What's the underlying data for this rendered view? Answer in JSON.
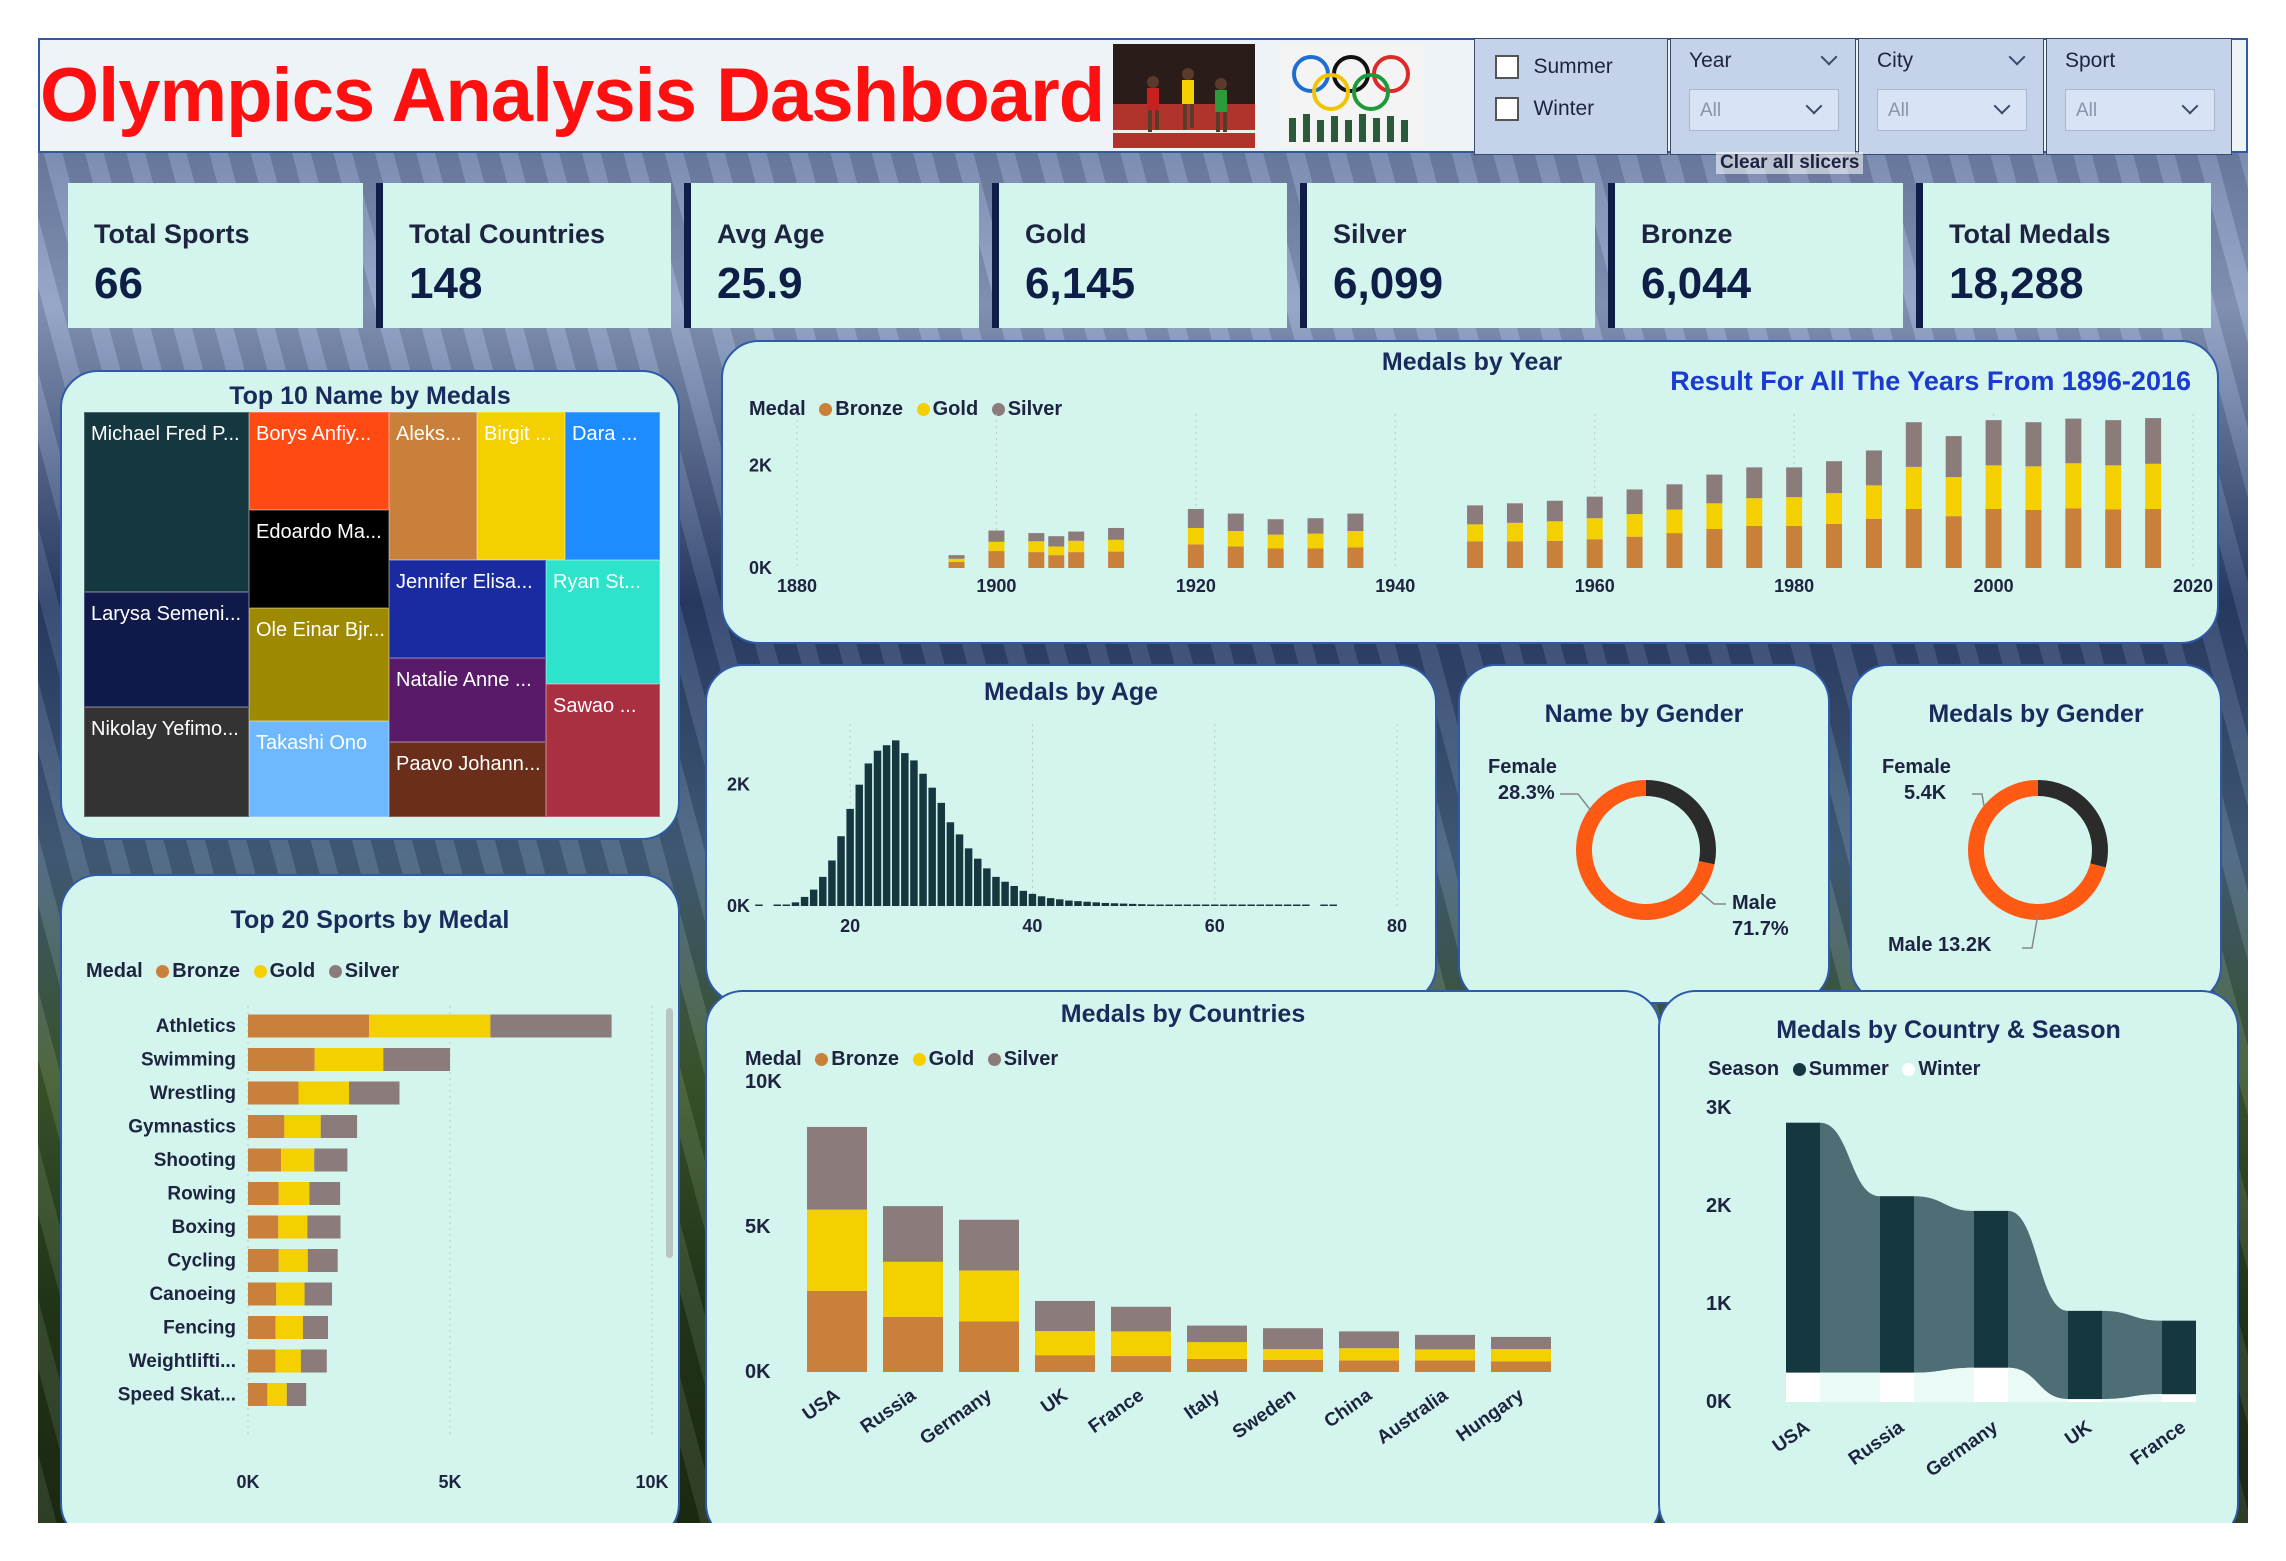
{
  "header": {
    "title": "Olympics Analysis Dashboard",
    "clear_slicers": "Clear all slicers"
  },
  "slicers": {
    "season_options": [
      "Summer",
      "Winter"
    ],
    "year": {
      "title": "Year",
      "value": "All"
    },
    "city": {
      "title": "City",
      "value": "All"
    },
    "sport": {
      "title": "Sport",
      "value": "All"
    }
  },
  "kpis": [
    {
      "label": "Total Sports",
      "value": "66"
    },
    {
      "label": "Total Countries",
      "value": "148"
    },
    {
      "label": "Avg Age",
      "value": "25.9"
    },
    {
      "label": "Gold",
      "value": "6,145"
    },
    {
      "label": "Silver",
      "value": "6,099"
    },
    {
      "label": "Bronze",
      "value": "6,044"
    },
    {
      "label": "Total Medals",
      "value": "18,288"
    }
  ],
  "colors": {
    "bronze": "#c9803a",
    "gold": "#f5d000",
    "silver": "#8c7b7b",
    "summer": "#15373f",
    "winter": "#ffffff",
    "female": "#2b2b2b",
    "male": "#ff5a14",
    "age_bar": "#15373f"
  },
  "treemap": {
    "title": "Top 10 Name by Medals",
    "cells": [
      {
        "label": "Michael Fred P...",
        "color": "#15373f"
      },
      {
        "label": "Larysa Semeni...",
        "color": "#101a4a"
      },
      {
        "label": "Nikolay Yefimo...",
        "color": "#333333"
      },
      {
        "label": "Borys Anfiy...",
        "color": "#ff4a14"
      },
      {
        "label": "Edoardo Ma...",
        "color": "#000000"
      },
      {
        "label": "Ole Einar Bjr...",
        "color": "#9e8a00"
      },
      {
        "label": "Takashi Ono",
        "color": "#6db8ff"
      },
      {
        "label": "Aleks...",
        "color": "#c9803a"
      },
      {
        "label": "Birgit ...",
        "color": "#f5d000"
      },
      {
        "label": "Dara ...",
        "color": "#1e8cff"
      },
      {
        "label": "Jennifer Elisa...",
        "color": "#1a2aa0"
      },
      {
        "label": "Ryan St...",
        "color": "#2ee3cc"
      },
      {
        "label": "Natalie Anne ...",
        "color": "#5a1a6a"
      },
      {
        "label": "Sawao ...",
        "color": "#a83040"
      },
      {
        "label": "Paavo Johann...",
        "color": "#6b2e1a"
      }
    ]
  },
  "medals_by_year": {
    "title": "Medals by Year",
    "subtitle": "Result For All The Years From 1896-2016",
    "legend_title": "Medal",
    "series_names": [
      "Bronze",
      "Gold",
      "Silver"
    ]
  },
  "medals_by_age": {
    "title": "Medals by Age"
  },
  "name_by_gender": {
    "title": "Name by Gender",
    "female_label": "Female",
    "female_value": "28.3%",
    "male_label": "Male",
    "male_value": "71.7%"
  },
  "medals_by_gender": {
    "title": "Medals by Gender",
    "female_label": "Female",
    "female_value": "5.4K",
    "male_label": "Male 13.2K"
  },
  "top_sports": {
    "title": "Top 20 Sports by Medal",
    "legend_title": "Medal",
    "series_names": [
      "Bronze",
      "Gold",
      "Silver"
    ]
  },
  "medals_by_countries": {
    "title": "Medals by Countries",
    "legend_title": "Medal",
    "series_names": [
      "Bronze",
      "Gold",
      "Silver"
    ]
  },
  "country_season": {
    "title": "Medals by Country & Season",
    "legend_title": "Season",
    "series_names": [
      "Summer",
      "Winter"
    ]
  },
  "chart_data": [
    {
      "id": "medals_by_year",
      "type": "bar",
      "title": "Medals by Year",
      "stacked": true,
      "xlim": [
        1880,
        2020
      ],
      "xticks": [
        1880,
        1900,
        1920,
        1940,
        1960,
        1980,
        2000,
        2020
      ],
      "ylim": [
        0,
        3000
      ],
      "yticks": [
        {
          "v": 0,
          "label": "0K"
        },
        {
          "v": 2000,
          "label": "2K"
        }
      ],
      "x": [
        1896,
        1900,
        1904,
        1906,
        1908,
        1912,
        1920,
        1924,
        1928,
        1932,
        1936,
        1948,
        1952,
        1956,
        1960,
        1964,
        1968,
        1972,
        1976,
        1980,
        1984,
        1988,
        1992,
        1994,
        1996,
        1998,
        2000,
        2002,
        2004,
        2006,
        2008,
        2010,
        2012,
        2014,
        2016
      ],
      "xpos": [
        1896,
        1900,
        1904,
        1906,
        1908,
        1912,
        1920,
        1924,
        1928,
        1932,
        1936,
        1948,
        1952,
        1956,
        1960,
        1964,
        1968,
        1972,
        1976,
        1980,
        1984,
        1988,
        1992,
        1996,
        2000,
        2004,
        2008,
        2012,
        2016
      ],
      "series": [
        {
          "name": "Bronze",
          "values": [
            120,
            330,
            310,
            250,
            310,
            320,
            460,
            420,
            380,
            380,
            400,
            520,
            520,
            530,
            560,
            610,
            680,
            760,
            820,
            820,
            860,
            960,
            1150,
            1010,
            1150,
            1130,
            1160,
            1140,
            1150
          ]
        },
        {
          "name": "Gold",
          "values": [
            60,
            180,
            210,
            170,
            220,
            230,
            320,
            300,
            270,
            290,
            320,
            330,
            360,
            380,
            410,
            440,
            460,
            500,
            540,
            560,
            600,
            650,
            820,
            760,
            850,
            850,
            880,
            860,
            880
          ]
        },
        {
          "name": "Silver",
          "values": [
            70,
            220,
            160,
            200,
            180,
            230,
            370,
            340,
            300,
            300,
            340,
            370,
            380,
            400,
            420,
            480,
            490,
            560,
            600,
            580,
            620,
            680,
            870,
            800,
            880,
            860,
            870,
            880,
            890
          ]
        }
      ]
    },
    {
      "id": "medals_by_age",
      "type": "bar",
      "title": "Medals by Age",
      "xlim": [
        10,
        80
      ],
      "xticks": [
        20,
        40,
        60,
        80
      ],
      "ylim": [
        0,
        3000
      ],
      "yticks": [
        {
          "v": 0,
          "label": "0K"
        },
        {
          "v": 2000,
          "label": "2K"
        }
      ],
      "x": [
        10,
        12,
        13,
        14,
        15,
        16,
        17,
        18,
        19,
        20,
        21,
        22,
        23,
        24,
        25,
        26,
        27,
        28,
        29,
        30,
        31,
        32,
        33,
        34,
        35,
        36,
        37,
        38,
        39,
        40,
        41,
        42,
        43,
        44,
        45,
        46,
        47,
        48,
        49,
        50,
        51,
        52,
        53,
        54,
        55,
        56,
        57,
        58,
        59,
        60,
        61,
        62,
        63,
        64,
        65,
        66,
        67,
        68,
        69,
        70,
        72,
        73
      ],
      "values": [
        5,
        10,
        20,
        60,
        150,
        270,
        480,
        750,
        1150,
        1600,
        2000,
        2350,
        2560,
        2650,
        2730,
        2520,
        2400,
        2180,
        1950,
        1700,
        1380,
        1180,
        950,
        780,
        620,
        480,
        400,
        330,
        250,
        200,
        160,
        130,
        110,
        90,
        80,
        70,
        60,
        50,
        45,
        40,
        35,
        30,
        25,
        22,
        20,
        15,
        12,
        10,
        10,
        8,
        8,
        7,
        6,
        5,
        5,
        4,
        4,
        3,
        3,
        3,
        2,
        2
      ]
    },
    {
      "id": "name_by_gender",
      "type": "pie",
      "title": "Name by Gender",
      "labels": [
        "Female",
        "Male"
      ],
      "values": [
        28.3,
        71.7
      ]
    },
    {
      "id": "medals_by_gender",
      "type": "pie",
      "title": "Medals by Gender",
      "labels": [
        "Female",
        "Male"
      ],
      "values": [
        5.4,
        13.2
      ]
    },
    {
      "id": "top_sports",
      "type": "bar",
      "orientation": "horizontal",
      "stacked": true,
      "title": "Top 20 Sports by Medal",
      "xlim": [
        0,
        10000
      ],
      "xticks": [
        {
          "v": 0,
          "label": "0K"
        },
        {
          "v": 5000,
          "label": "5K"
        },
        {
          "v": 10000,
          "label": "10K"
        }
      ],
      "categories": [
        "Athletics",
        "Swimming",
        "Wrestling",
        "Gymnastics",
        "Shooting",
        "Rowing",
        "Boxing",
        "Cycling",
        "Canoeing",
        "Fencing",
        "Weightlifti...",
        "Speed Skat..."
      ],
      "series": [
        {
          "name": "Bronze",
          "values": [
            3000,
            1650,
            1250,
            900,
            820,
            760,
            750,
            760,
            700,
            680,
            680,
            480
          ]
        },
        {
          "name": "Gold",
          "values": [
            3000,
            1700,
            1250,
            900,
            820,
            760,
            720,
            720,
            700,
            680,
            630,
            480
          ]
        },
        {
          "name": "Silver",
          "values": [
            3000,
            1650,
            1250,
            900,
            820,
            760,
            820,
            740,
            680,
            620,
            640,
            480
          ]
        }
      ]
    },
    {
      "id": "medals_by_countries",
      "type": "bar",
      "stacked": true,
      "title": "Medals by Countries",
      "ylim": [
        0,
        10000
      ],
      "yticks": [
        {
          "v": 0,
          "label": "0K"
        },
        {
          "v": 5000,
          "label": "5K"
        },
        {
          "v": 10000,
          "label": "10K"
        }
      ],
      "categories": [
        "USA",
        "Russia",
        "Germany",
        "UK",
        "France",
        "Italy",
        "Sweden",
        "China",
        "Australia",
        "Hungary"
      ],
      "series": [
        {
          "name": "Bronze",
          "values": [
            2800,
            1900,
            1750,
            580,
            550,
            450,
            420,
            400,
            400,
            370
          ]
        },
        {
          "name": "Gold",
          "values": [
            2800,
            1900,
            1750,
            830,
            850,
            580,
            370,
            420,
            380,
            420
          ]
        },
        {
          "name": "Silver",
          "values": [
            2850,
            1920,
            1750,
            1040,
            850,
            570,
            720,
            580,
            500,
            420
          ]
        }
      ]
    },
    {
      "id": "country_season",
      "type": "area",
      "title": "Medals by Country & Season",
      "ylim": [
        0,
        3000
      ],
      "yticks": [
        {
          "v": 0,
          "label": "0K"
        },
        {
          "v": 1000,
          "label": "1K"
        },
        {
          "v": 2000,
          "label": "2K"
        },
        {
          "v": 3000,
          "label": "3K"
        }
      ],
      "categories": [
        "USA",
        "Russia",
        "Germany",
        "UK",
        "France"
      ],
      "series": [
        {
          "name": "Summer",
          "values": [
            2550,
            1800,
            1600,
            900,
            750
          ]
        },
        {
          "name": "Winter",
          "values": [
            300,
            300,
            350,
            30,
            80
          ]
        }
      ]
    }
  ]
}
